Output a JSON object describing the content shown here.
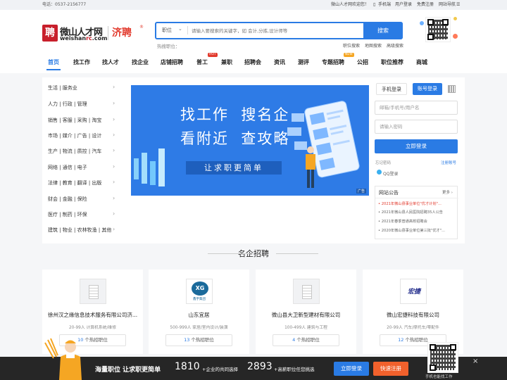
{
  "topbar": {
    "hotline": "电话：0537-2156777",
    "welcome": "微山人才网欢迎您！",
    "mobile": "手机端",
    "user_login": "用户登录",
    "free_register": "免费注册",
    "site_nav": "网站导航"
  },
  "logo": {
    "mark": "聘",
    "cn": "微山人才网",
    "en_a": "weishan",
    "en_b": "rc",
    "en_c": ".com",
    "jp": "济聘",
    "reg": "®"
  },
  "search": {
    "type": "职位",
    "placeholder": "请输入要搜索的关键字，如 会计,分拣,设计师等",
    "button": "搜索",
    "hot_label": "热搜职位：",
    "links": [
      "职位搜索",
      "地图搜索",
      "高级搜索"
    ]
  },
  "nav": {
    "items": [
      "首页",
      "找工作",
      "找人才",
      "找企业",
      "店铺招聘",
      "普工",
      "兼职",
      "招聘会",
      "资讯",
      "测评",
      "专题招聘",
      "公招",
      "职位推荐",
      "商城"
    ],
    "badge_hot": "HOT",
    "badge_new": "NEW"
  },
  "categories": [
    "生活 | 服务业",
    "人力 | 行政 | 管理",
    "销售 | 客服 | 采购 | 淘宝",
    "市场 | 媒介 | 广告 | 设计",
    "生产 | 物流 | 质控 | 汽车",
    "网络 | 通信 | 电子",
    "法律 | 教育 | 翻译 | 出版",
    "财会 | 金融 | 保险",
    "医疗 | 制药 | 环保",
    "建筑 | 物业 | 农林牧渔 | 其他"
  ],
  "banner": {
    "line1a": "找工作",
    "line1b": "搜名企",
    "line2a": "看附近",
    "line2b": "查攻略",
    "slogan": "让求职更简单",
    "ad": "广告"
  },
  "login": {
    "tab_mobile": "手机登录",
    "tab_account": "账号登录",
    "user_placeholder": "邮箱/手机号/用户名",
    "pwd_placeholder": "请输入密码",
    "submit": "立即登录",
    "forgot": "忘记密码",
    "register": "注册账号",
    "qq": "QQ登录"
  },
  "notice": {
    "title": "网站公告",
    "more": "更多",
    "items": [
      "2021年微山县事业单位\"优才计划\"...",
      "2021年微山县人民医院招聘35人公告",
      "2021年春季普通高校招聘会",
      "2020年微山县事业单位第三批\"优才\"..."
    ]
  },
  "famous": {
    "title": "名企招聘",
    "companies": [
      {
        "name": "徐州汉之缘信息技术服务有限公司济...",
        "detail": "20-99人 计算机系统/维修",
        "count": "10",
        "suffix": "个热招职位"
      },
      {
        "name": "山东宜居",
        "detail": "500-999人 家居/室内设计/装潢",
        "count": "13",
        "suffix": "个热招职位",
        "logo_text": "XG",
        "logo_sub": "鑫宇集团"
      },
      {
        "name": "微山县大卫新型建材有限公司",
        "detail": "100-499人 建筑与工程",
        "count": "4",
        "suffix": "个热招职位"
      },
      {
        "name": "微山宏捷科技有限公司",
        "detail": "20-99人 汽车/摩托车/零配件",
        "count": "12",
        "suffix": "个热招职位",
        "logo_text": "宏捷"
      }
    ]
  },
  "footer": {
    "slogan": "海量职位 让求职更简单",
    "num1": "1810",
    "txt1": "+企业的共同选择",
    "num2": "2893",
    "txt2": "+高薪职位任您挑选",
    "login": "立即登录",
    "register": "快速注册",
    "qr_caption": "手机也能找工作",
    "close": "×"
  },
  "colors": {
    "primary": "#2a7be4",
    "brand_red": "#c81f2b",
    "orange": "#f2612c"
  }
}
